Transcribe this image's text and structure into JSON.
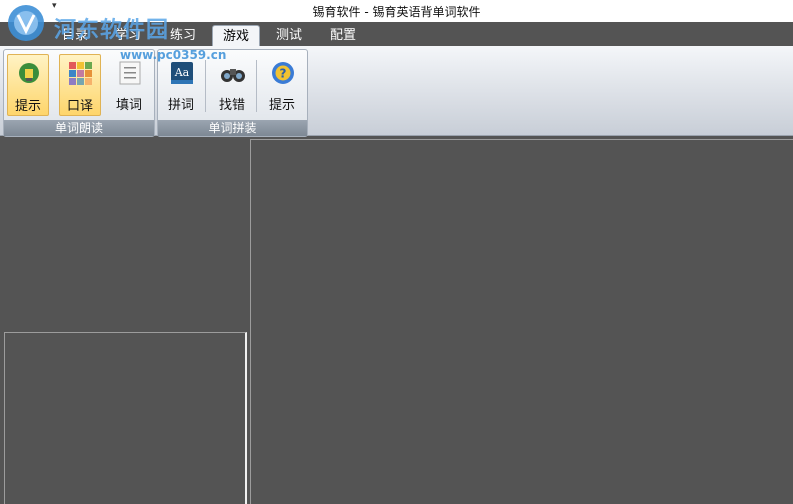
{
  "window": {
    "title": "锡育软件 - 锡育英语背单词软件"
  },
  "watermark": {
    "text": "河东软件园",
    "url": "www.pc0359.cn"
  },
  "tabs": [
    {
      "label": "目录"
    },
    {
      "label": "学习"
    },
    {
      "label": "练习"
    },
    {
      "label": "游戏"
    },
    {
      "label": "测试"
    },
    {
      "label": "配置"
    }
  ],
  "ribbon": {
    "groups": [
      {
        "label": "单词朗读",
        "buttons": [
          {
            "label": "提示"
          },
          {
            "label": "口译"
          },
          {
            "label": "填词"
          }
        ]
      },
      {
        "label": "单词拼装",
        "buttons": [
          {
            "label": "拼词"
          },
          {
            "label": "找错"
          },
          {
            "label": "提示"
          }
        ]
      }
    ]
  },
  "icons": {
    "word_tip": "lightbulb-icon",
    "interpret": "color-grid-icon",
    "fill_word": "list-icon",
    "spell_word": "dictionary-icon",
    "find_error": "binoculars-icon",
    "tip": "question-icon"
  },
  "colors": {
    "workspace": "#545454",
    "active_button": "#fed56b",
    "watermark": "#5aa6e8"
  }
}
